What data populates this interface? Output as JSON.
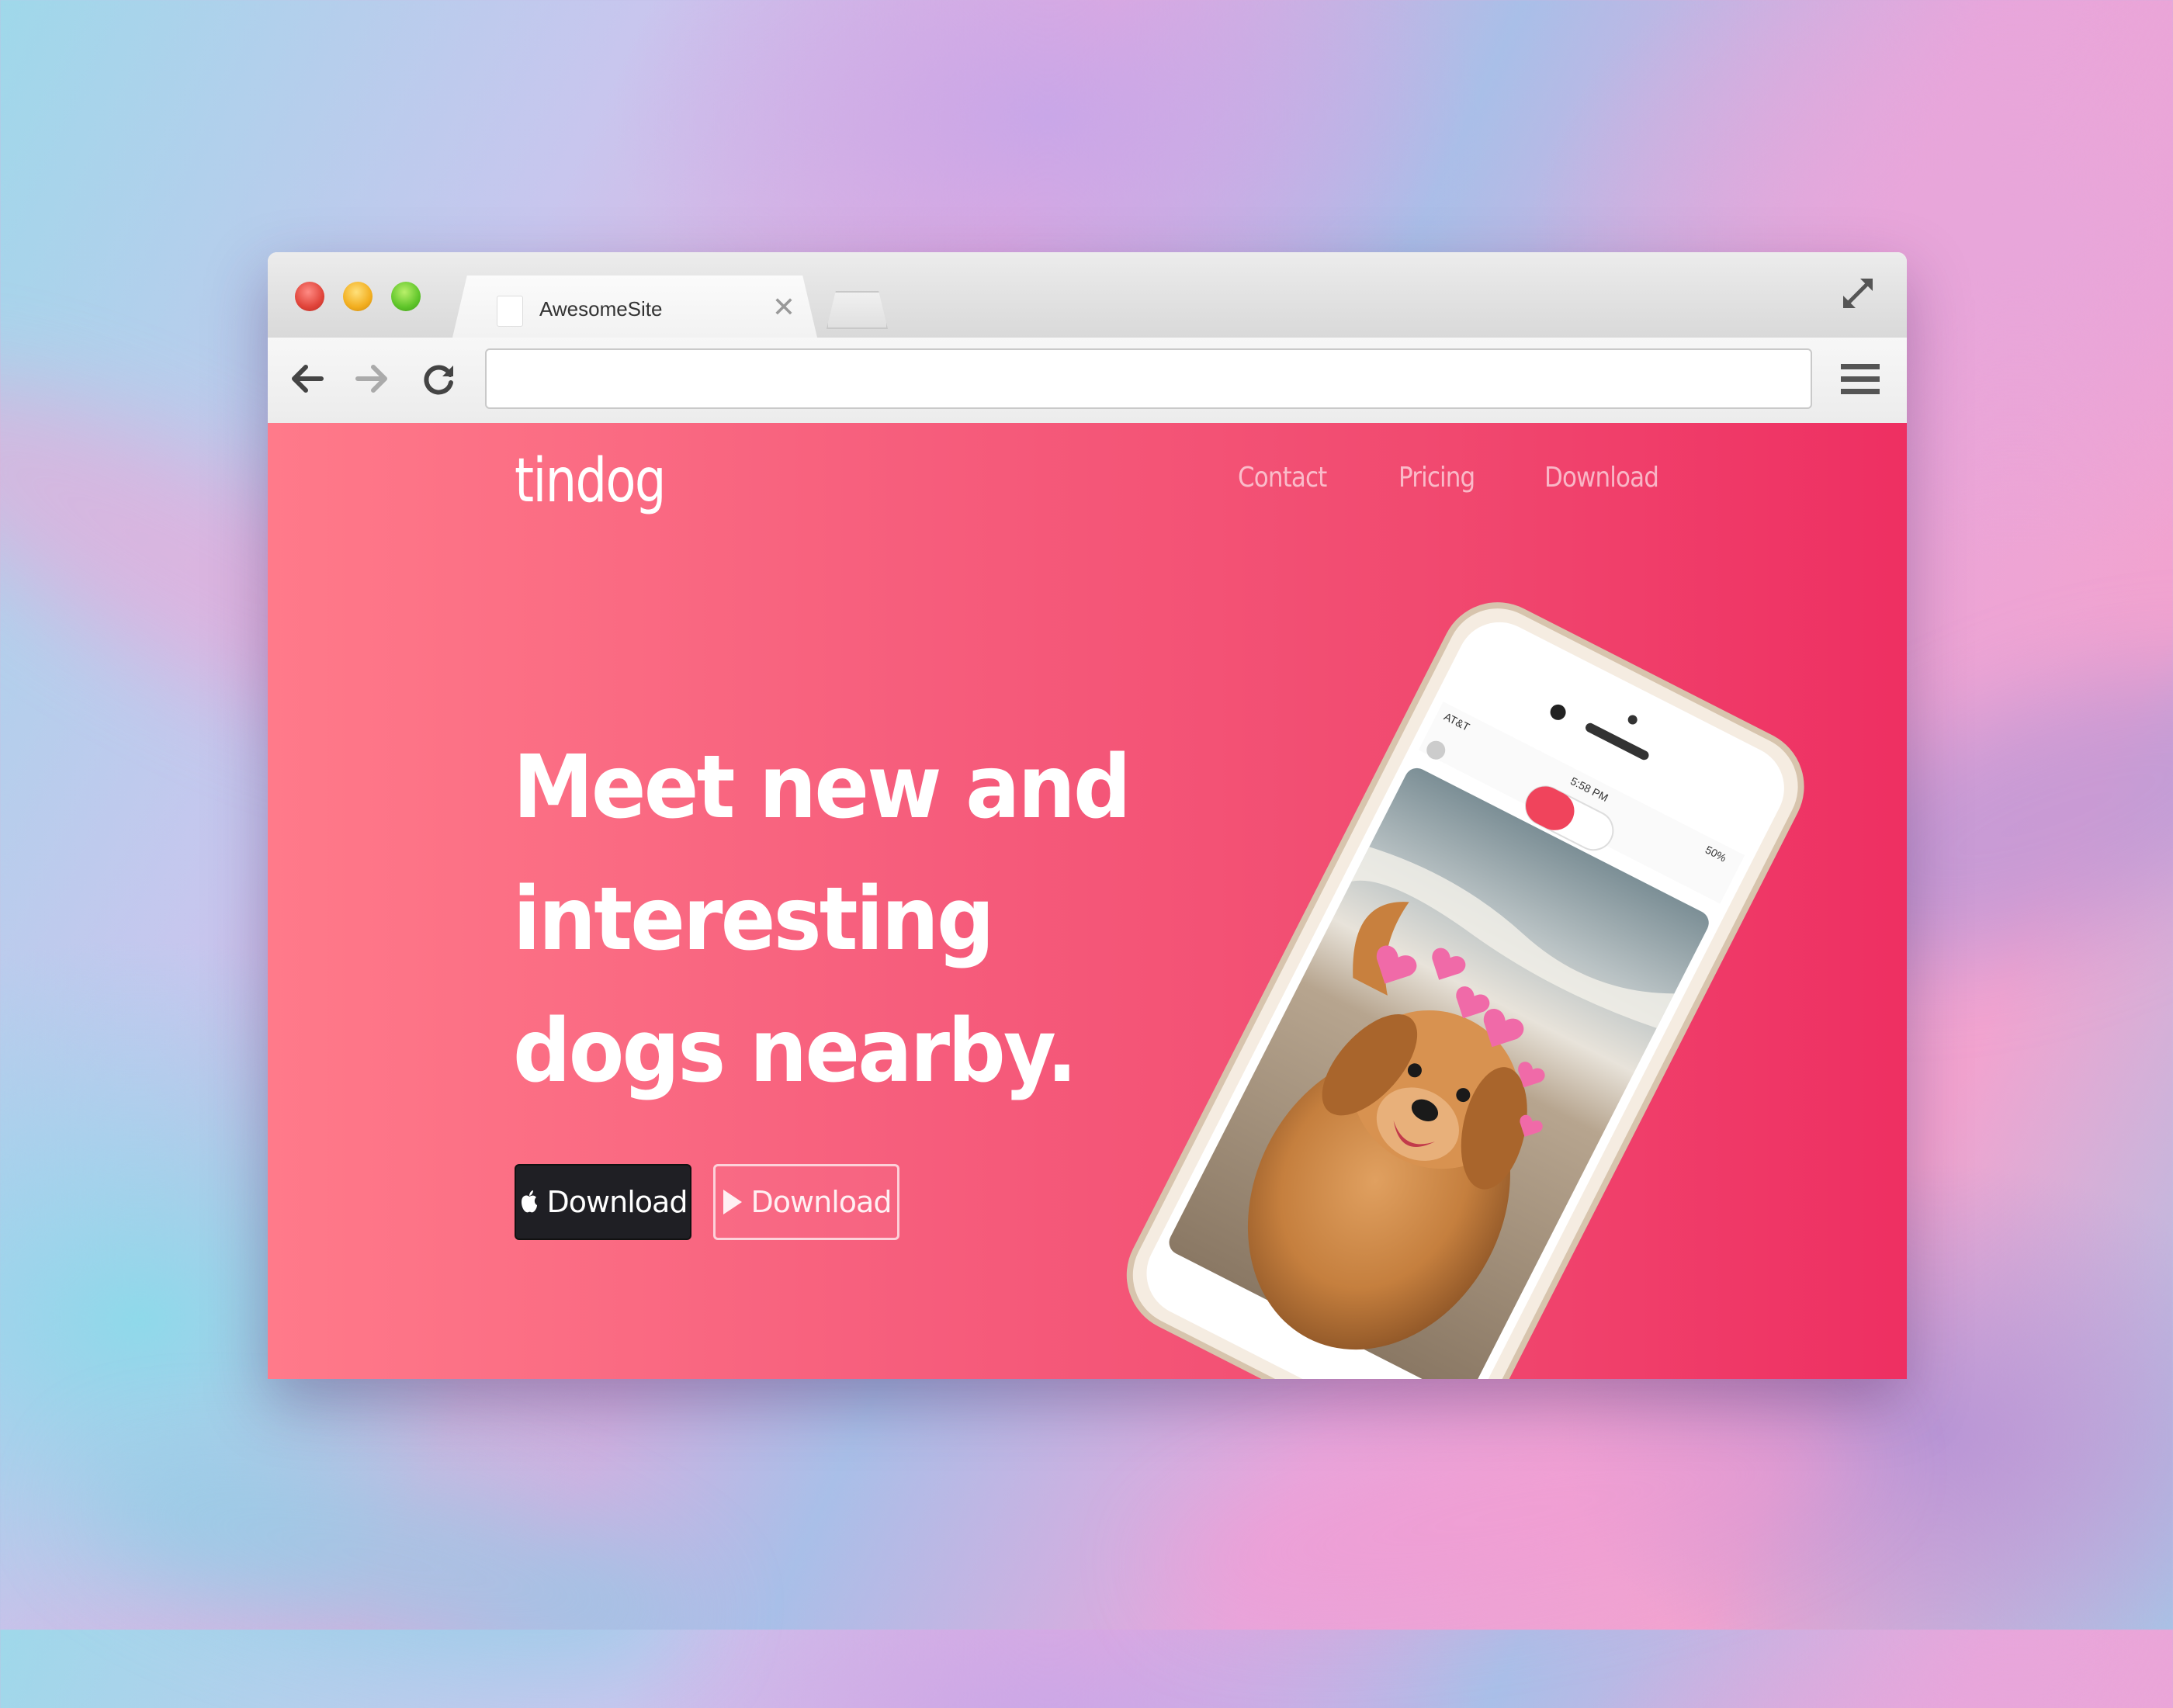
{
  "browser": {
    "tab_title": "AwesomeSite",
    "url": ""
  },
  "site": {
    "brand": "tindog",
    "nav": [
      "Contact",
      "Pricing",
      "Download"
    ],
    "headline": [
      "Meet new and",
      "interesting",
      "dogs nearby."
    ],
    "buttons": {
      "apple_download": "Download",
      "google_download": "Download"
    }
  },
  "phone": {
    "carrier": "AT&T",
    "time": "5:58 PM",
    "battery": "50%"
  },
  "colors": {
    "hero_start": "#ff7a8a",
    "hero_end": "#ee2f62",
    "dark_button": "#1f1f24"
  }
}
